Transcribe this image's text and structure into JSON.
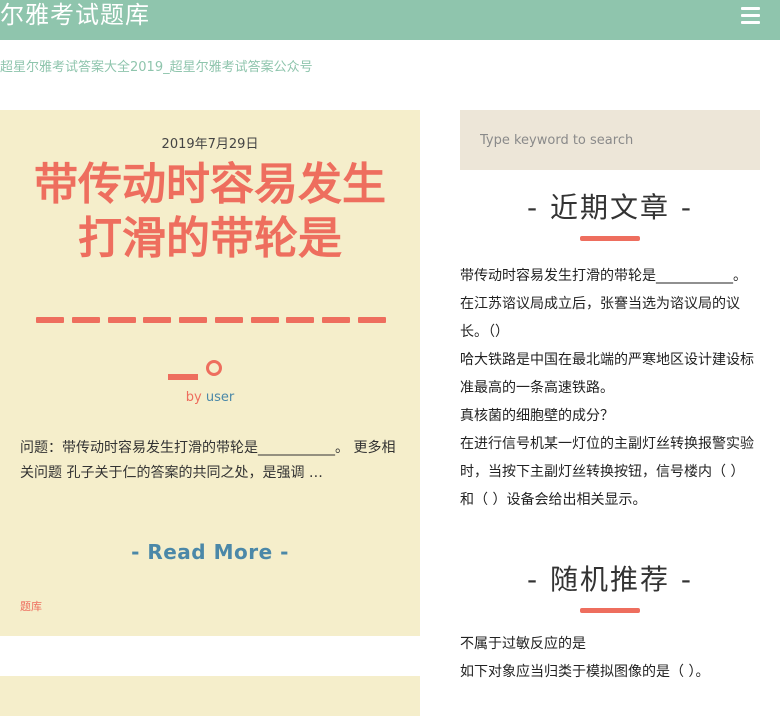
{
  "header": {
    "site_title": "尔雅考试题库",
    "menu_icon": "hamburger-menu-icon",
    "background": "#8fc5ad"
  },
  "site_description": "超星尔雅考试答案大全2019_超星尔雅考试答案公众号",
  "post": {
    "date": "2019年7月29日",
    "title": "带传动时容易发生打滑的带轮是",
    "by_label": "by",
    "author": "user",
    "excerpt": "问题：带传动时容易发生打滑的带轮是___________。 更多相关问题 孔子关于仁的答案的共同之处，是强调 …",
    "read_more": "- Read More -",
    "category": "题库"
  },
  "sidebar": {
    "search_placeholder": "Type keyword to search",
    "recent_title": "- 近期文章 -",
    "recent_posts": [
      "带传动时容易发生打滑的带轮是___________。",
      "在江苏谘议局成立后，张謇当选为谘议局的议长。（）",
      "哈大铁路是中国在最北端的严寒地区设计建设标准最高的一条高速铁路。",
      "真核菌的细胞壁的成分？",
      "在进行信号机某一灯位的主副灯丝转换报警实验时，当按下主副灯丝转换按钮，信号楼内（ ）和（ ）设备会给出相关显示。"
    ],
    "random_title": "- 随机推荐 -",
    "random_posts": [
      "不属于过敏反应的是",
      "如下对象应当归类于模拟图像的是（ ）。"
    ]
  },
  "colors": {
    "accent": "#ee6e5e",
    "link": "#4b88a8",
    "card": "#f5eecb",
    "search_bg": "#ede6d8"
  }
}
